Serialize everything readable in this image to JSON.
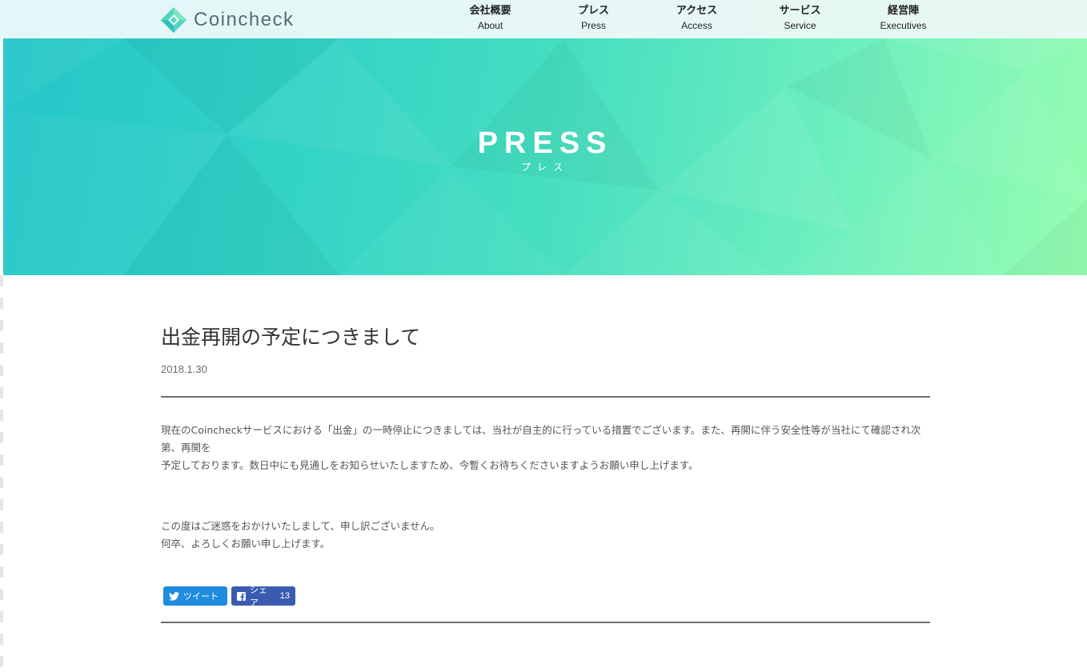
{
  "header": {
    "logo_text": "Coincheck",
    "nav": [
      {
        "ja": "会社概要",
        "en": "About"
      },
      {
        "ja": "プレス",
        "en": "Press"
      },
      {
        "ja": "アクセス",
        "en": "Access"
      },
      {
        "ja": "サービス",
        "en": "Service"
      },
      {
        "ja": "経営陣",
        "en": "Executives"
      }
    ]
  },
  "hero": {
    "title": "PRESS",
    "subtitle": "プレス"
  },
  "article": {
    "title": "出金再開の予定につきまして",
    "date": "2018.1.30",
    "paragraph1_line1": "現在のCoincheckサービスにおける「出金」の一時停止につきましては、当社が自主的に行っている措置でございます。また、再開に伴う安全性等が当社にて確認され次第、再開を",
    "paragraph1_line2": "予定しております。数日中にも見通しをお知らせいたしますため、今暫くお待ちくださいますようお願い申し上げます。",
    "paragraph2_line1": "この度はご迷惑をおかけいたしまして、申し訳ございません。",
    "paragraph2_line2": "何卒、よろしくお願い申し上げます。"
  },
  "share": {
    "tweet_label": "ツイート",
    "share_label": "シェア",
    "share_count": "13"
  },
  "colors": {
    "hero_start": "#24c6c9",
    "hero_end": "#96fdb1",
    "tweet_button": "#1f8ce0",
    "share_button": "#3b5bb0"
  },
  "icons": [
    "coincheck-logo-icon",
    "twitter-icon",
    "facebook-icon"
  ]
}
